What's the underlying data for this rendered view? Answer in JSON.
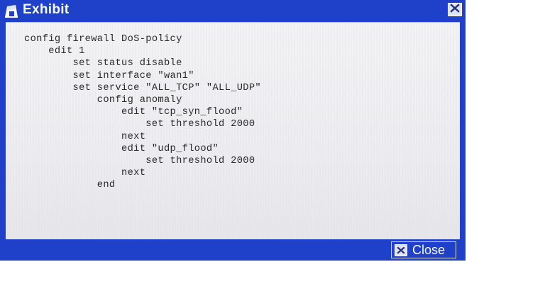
{
  "window": {
    "title": "Exhibit",
    "close_button_label": "Close"
  },
  "code_lines": [
    "config firewall DoS-policy",
    "    edit 1",
    "        set status disable",
    "        set interface \"wan1\"",
    "        set service \"ALL_TCP\" \"ALL_UDP\"",
    "            config anomaly",
    "                edit \"tcp_syn_flood\"",
    "                    set threshold 2000",
    "                next",
    "                edit \"udp_flood\"",
    "                    set threshold 2000",
    "                next",
    "            end"
  ],
  "colors": {
    "titlebar": "#1f40c8",
    "content_bg": "#f0f0f3",
    "text": "#2a2a2a"
  },
  "icons": {
    "title": "exhibit-icon",
    "close": "close-x-icon"
  }
}
